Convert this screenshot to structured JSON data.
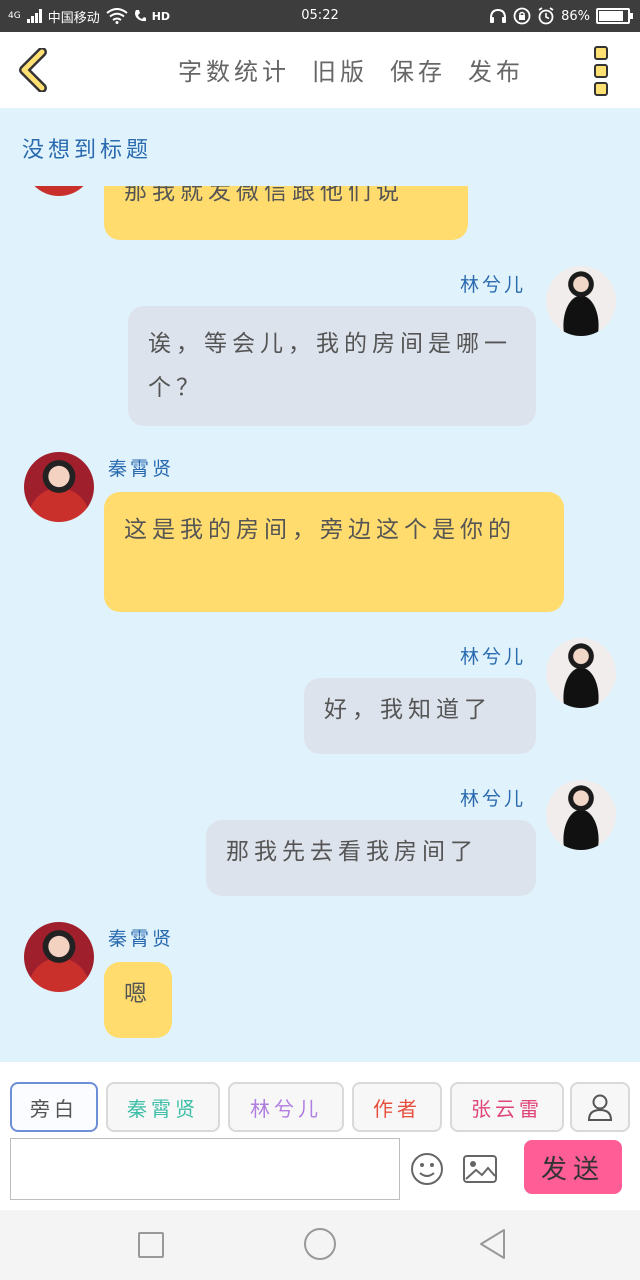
{
  "status_bar": {
    "network": "4G",
    "carrier": "中国移动",
    "hd": "HD",
    "time": "05:22",
    "battery": "86%",
    "battery_level": 0.86
  },
  "toolbar": {
    "stats": "字数统计",
    "old_version": "旧版",
    "save": "保存",
    "publish": "发布"
  },
  "story_title": "没想到标题",
  "chat": {
    "messages": [
      {
        "side": "left",
        "text": "那我就发微信跟他们说"
      },
      {
        "side": "right",
        "name": "林兮儿",
        "text": "诶，等会儿，我的房间是哪一个？"
      },
      {
        "side": "left",
        "name": "秦霄贤",
        "text": "这是我的房间，旁边这个是你的"
      },
      {
        "side": "right",
        "name": "林兮儿",
        "text": "好，我知道了"
      },
      {
        "side": "right",
        "name": "林兮儿",
        "text": "那我先去看我房间了"
      },
      {
        "side": "left",
        "name": "秦霄贤",
        "text": "嗯"
      }
    ]
  },
  "roles": [
    {
      "label": "旁白",
      "color": "#555555"
    },
    {
      "label": "秦霄贤",
      "color": "#3fbfa8"
    },
    {
      "label": "林兮儿",
      "color": "#b07de0"
    },
    {
      "label": "作者",
      "color": "#e8503e"
    },
    {
      "label": "张云雷",
      "color": "#e0457a"
    }
  ],
  "composer": {
    "input_value": "",
    "send": "发送"
  },
  "colors": {
    "chat_bg": "#e0f2fb",
    "left_bubble": "#ffdc6d",
    "right_bubble": "#dde3ec",
    "name": "#2a6bb0",
    "send_button": "#ff5d96"
  }
}
